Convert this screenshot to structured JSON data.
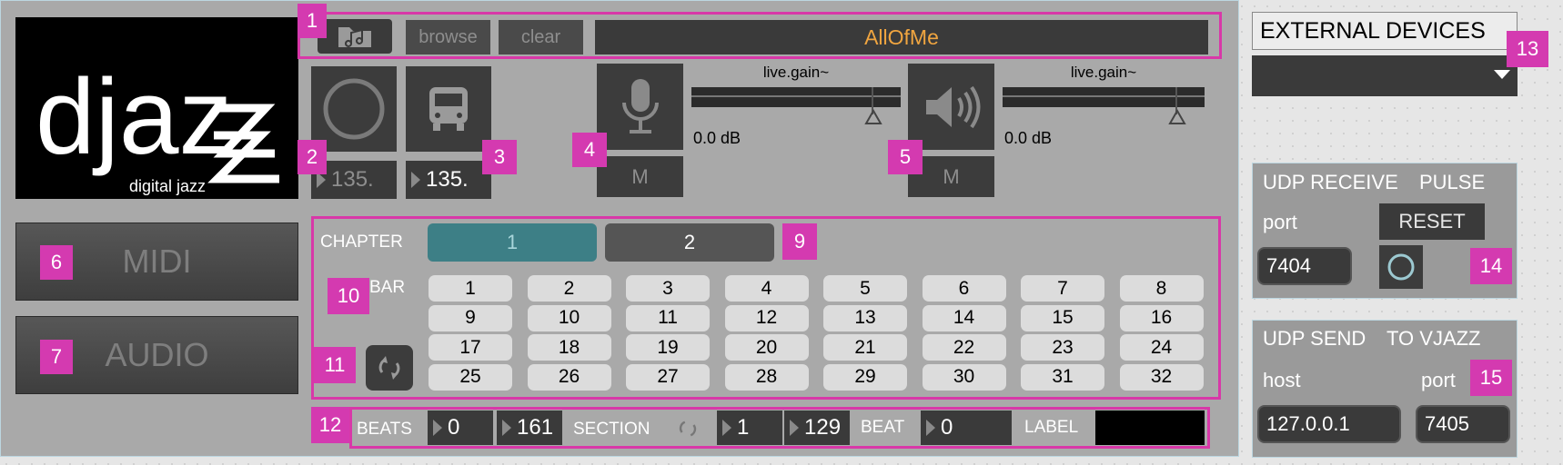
{
  "header": {
    "browse_label": "browse",
    "clear_label": "clear",
    "file_name": "AllOfMe",
    "folder_icon": "music-folder-icon"
  },
  "logo": {
    "brand": "djazz",
    "tagline": "digital jazz"
  },
  "badges": [
    "1",
    "2",
    "3",
    "4",
    "5",
    "6",
    "7",
    "8",
    "9",
    "10",
    "11",
    "12",
    "13",
    "14",
    "15"
  ],
  "tempo": {
    "value_a": "135.",
    "value_b": "135."
  },
  "mic": {
    "gain_label": "live.gain~",
    "db": "0.0 dB",
    "mute": "M",
    "icon": "microphone-icon",
    "level": 0.0
  },
  "speaker": {
    "gain_label": "live.gain~",
    "db": "0.0 dB",
    "mute": "M",
    "icon": "speaker-icon",
    "level": 0.0
  },
  "modes": {
    "midi": "MIDI",
    "audio": "AUDIO"
  },
  "chapter": {
    "label": "CHAPTER",
    "items": [
      "1",
      "2"
    ],
    "selected": "1"
  },
  "bar": {
    "label": "BAR",
    "cells": [
      "1",
      "2",
      "3",
      "4",
      "5",
      "6",
      "7",
      "8",
      "9",
      "10",
      "11",
      "12",
      "13",
      "14",
      "15",
      "16",
      "17",
      "18",
      "19",
      "20",
      "21",
      "22",
      "23",
      "24",
      "25",
      "26",
      "27",
      "28",
      "29",
      "30",
      "31",
      "32"
    ]
  },
  "status": {
    "beats_label": "BEATS",
    "beats_value": "0",
    "beats_total": "161",
    "section_label": "SECTION",
    "section_value": "1",
    "section_total": "129",
    "beat_label": "BEAT",
    "beat_value": "0",
    "label_label": "LABEL",
    "label_value": ""
  },
  "external": {
    "title": "EXTERNAL DEVICES",
    "selected": ""
  },
  "udp_receive": {
    "title": "UDP RECEIVE",
    "pulse": "PULSE",
    "port_label": "port",
    "reset": "RESET",
    "port_value": "7404"
  },
  "udp_send": {
    "title": "UDP SEND",
    "to": "TO VJAZZ",
    "host_label": "host",
    "port_label": "port",
    "host_value": "127.0.0.1",
    "port_value": "7405"
  },
  "colors": {
    "accent_teal": "#3d7f86",
    "highlight_pink": "#d43ab0",
    "file_name": "#f0a540"
  }
}
